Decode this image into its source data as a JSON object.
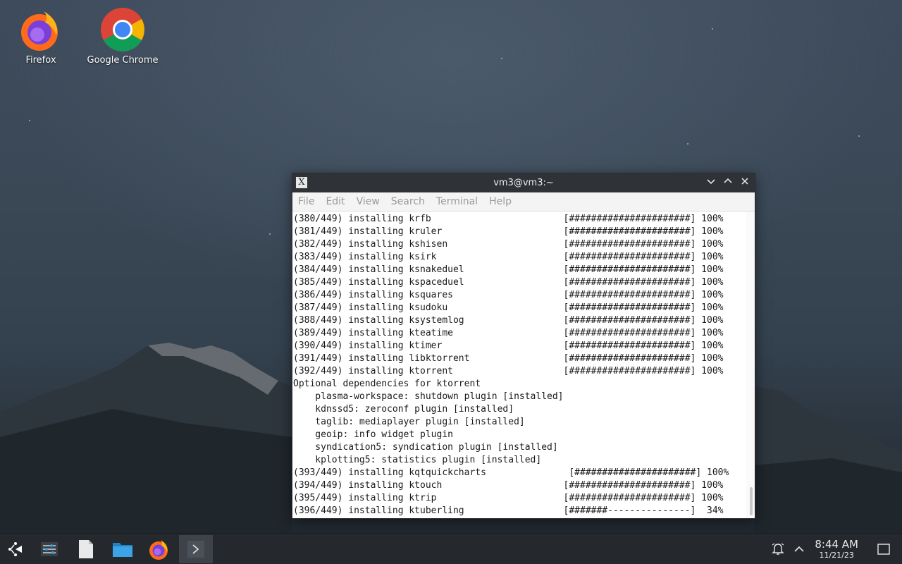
{
  "desktop": {
    "icons": [
      {
        "label": "Firefox",
        "icon": "firefox-icon"
      },
      {
        "label": "Google Chrome",
        "icon": "chrome-icon"
      }
    ]
  },
  "terminal": {
    "title": "vm3@vm3:~",
    "menu": [
      "File",
      "Edit",
      "View",
      "Search",
      "Terminal",
      "Help"
    ],
    "lines": [
      "(380/449) installing krfb                        [######################] 100%",
      "(381/449) installing kruler                      [######################] 100%",
      "(382/449) installing kshisen                     [######################] 100%",
      "(383/449) installing ksirk                       [######################] 100%",
      "(384/449) installing ksnakeduel                  [######################] 100%",
      "(385/449) installing kspaceduel                  [######################] 100%",
      "(386/449) installing ksquares                    [######################] 100%",
      "(387/449) installing ksudoku                     [######################] 100%",
      "(388/449) installing ksystemlog                  [######################] 100%",
      "(389/449) installing kteatime                    [######################] 100%",
      "(390/449) installing ktimer                      [######################] 100%",
      "(391/449) installing libktorrent                 [######################] 100%",
      "(392/449) installing ktorrent                    [######################] 100%",
      "Optional dependencies for ktorrent",
      "    plasma-workspace: shutdown plugin [installed]",
      "    kdnssd5: zeroconf plugin [installed]",
      "    taglib: mediaplayer plugin [installed]",
      "    geoip: info widget plugin",
      "    syndication5: syndication plugin [installed]",
      "    kplotting5: statistics plugin [installed]",
      "(393/449) installing kqtquickcharts               [######################] 100%",
      "(394/449) installing ktouch                      [######################] 100%",
      "(395/449) installing ktrip                       [######################] 100%",
      "(396/449) installing ktuberling                  [#######---------------]  34%"
    ]
  },
  "taskbar": {
    "items": [
      "app-launcher-icon",
      "task-manager-icon",
      "text-file-icon",
      "folder-icon",
      "firefox-icon",
      "terminal-icon"
    ],
    "clock": {
      "time": "8:44 AM",
      "date": "11/21/23"
    }
  }
}
